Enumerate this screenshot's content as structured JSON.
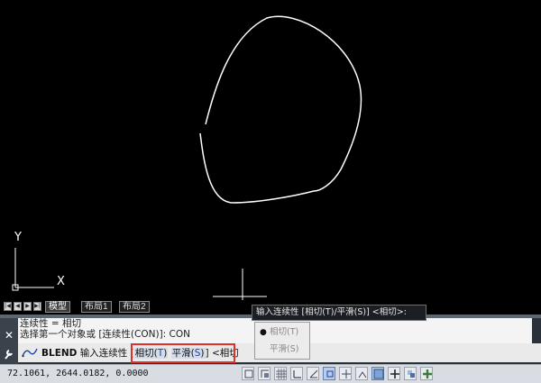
{
  "model_space": {
    "ucs_x_label": "X",
    "ucs_y_label": "Y"
  },
  "layout_tabs": {
    "nav_buttons": [
      "|◀",
      "◀",
      "▶",
      "▶|"
    ],
    "tabs": [
      {
        "label": "模型",
        "active": true
      },
      {
        "label": "布局1",
        "active": false
      },
      {
        "label": "布局2",
        "active": false
      }
    ]
  },
  "command_window": {
    "history": [
      "连续性 = 相切",
      "选择第一个对象或 [连续性(CON)]: CON"
    ],
    "input": {
      "command": "BLEND",
      "prompt": "输入连续性 [",
      "option1_label": "相切(",
      "option1_key": "T",
      "option1_close": ")",
      "option2_label": "平滑(",
      "option2_key": "S",
      "option2_close": ")",
      "prompt_end": "]",
      "trailing": " <相切"
    }
  },
  "tooltip": {
    "text": "输入连续性 [相切(T)/平滑(S)] <相切>:"
  },
  "dropdown": {
    "options": [
      {
        "label": "相切(T)",
        "selected": true
      },
      {
        "label": "平滑(S)",
        "selected": false
      }
    ]
  },
  "status_bar": {
    "coordinates": "72.1061,  2644.0182, 0.0000"
  },
  "colors": {
    "canvas_bg": "#000000",
    "curve": "#ffffff",
    "command_bg": "#2b3138",
    "highlight": "#e0302a",
    "keyword": "#1b3fa8"
  }
}
